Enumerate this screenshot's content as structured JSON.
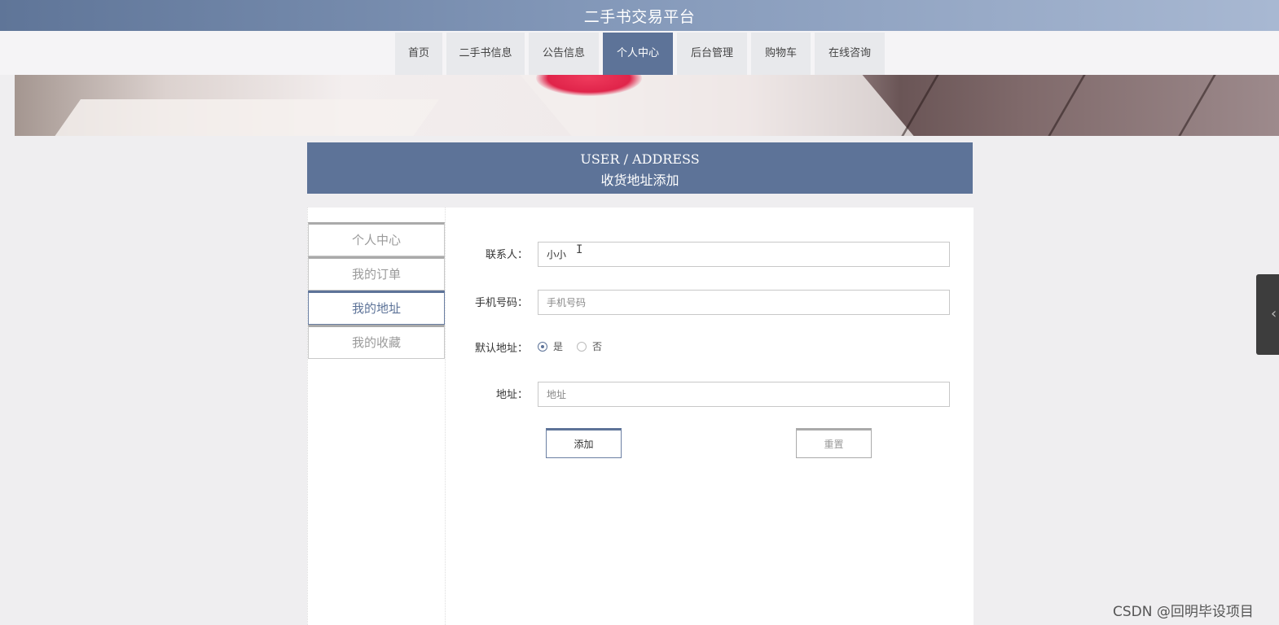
{
  "site": {
    "title": "二手书交易平台"
  },
  "nav": {
    "items": [
      {
        "label": "首页",
        "active": false
      },
      {
        "label": "二手书信息",
        "active": false
      },
      {
        "label": "公告信息",
        "active": false
      },
      {
        "label": "个人中心",
        "active": true
      },
      {
        "label": "后台管理",
        "active": false
      },
      {
        "label": "购物车",
        "active": false
      },
      {
        "label": "在线咨询",
        "active": false
      }
    ]
  },
  "section": {
    "title_en": "USER / ADDRESS",
    "title_cn": "收货地址添加"
  },
  "sidebar": {
    "items": [
      {
        "label": "个人中心",
        "active": false
      },
      {
        "label": "我的订单",
        "active": false
      },
      {
        "label": "我的地址",
        "active": true
      },
      {
        "label": "我的收藏",
        "active": false
      }
    ]
  },
  "form": {
    "contact": {
      "label": "联系人：",
      "value": "小小",
      "placeholder": ""
    },
    "phone": {
      "label": "手机号码：",
      "value": "",
      "placeholder": "手机号码"
    },
    "default": {
      "label": "默认地址：",
      "options": [
        "是",
        "否"
      ],
      "selected": "是"
    },
    "address": {
      "label": "地址：",
      "value": "",
      "placeholder": "地址"
    },
    "add_label": "添加",
    "reset_label": "重置"
  },
  "icons": {
    "text_cursor": "I-beam-cursor-icon",
    "float_tab": "chevron-left-icon"
  },
  "colors": {
    "accent": "#5d7398",
    "header_gradient_start": "#5f7598",
    "header_gradient_end": "#a8b8d2",
    "page_bg": "#efeef0"
  },
  "watermark": "CSDN @回明毕设项目"
}
